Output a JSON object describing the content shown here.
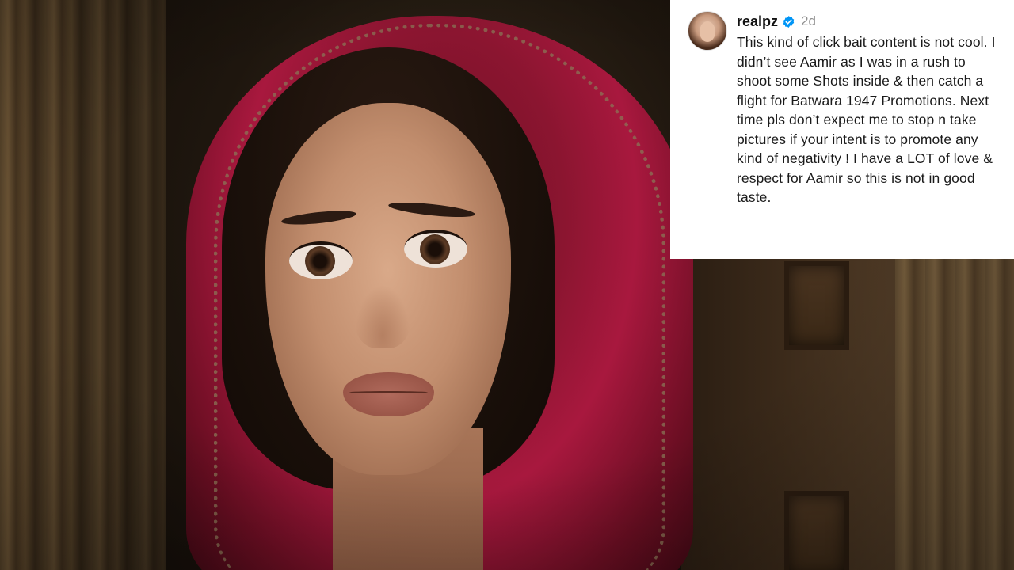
{
  "comment": {
    "username": "realpz",
    "verified": true,
    "time_ago": "2d",
    "text": "This kind of click bait content is not cool. I didn’t see Aamir as I was in a rush to shoot some Shots inside & then catch a flight for Batwara 1947 Promotions. Next time pls don’t expect me to stop n take pictures if your intent is to promote any kind of negativity ! I have a LOT of love & respect for Aamir so this is not in good taste."
  },
  "icons": {
    "verified": "verified-badge-icon",
    "avatar": "profile-avatar"
  },
  "colors": {
    "verified_blue": "#0095f6",
    "card_bg": "#ffffff",
    "time_gray": "#8e8e8e",
    "scarf_red": "#a8183e"
  }
}
